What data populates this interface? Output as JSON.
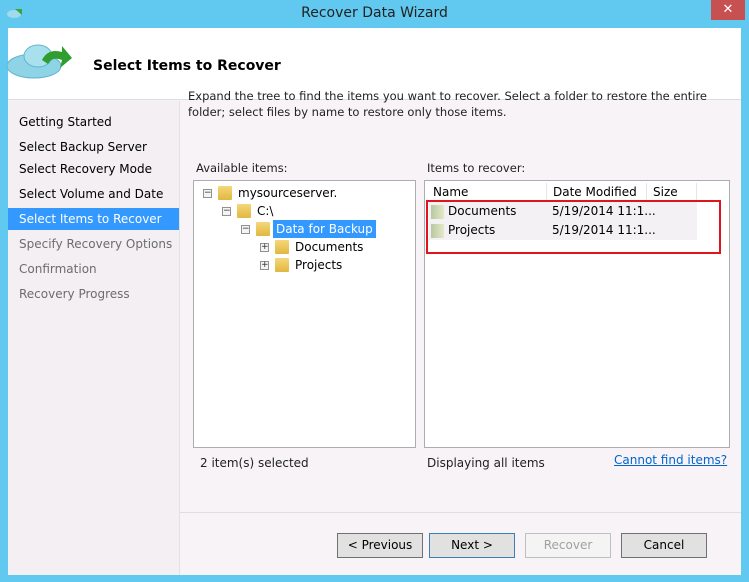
{
  "window": {
    "title": "Recover Data Wizard",
    "close_label": "✕"
  },
  "header": {
    "title": "Select Items to Recover"
  },
  "sidebar": {
    "items": [
      {
        "label": "Getting Started",
        "state": "done"
      },
      {
        "label": "Select Backup Server",
        "state": "done"
      },
      {
        "label": "Select Recovery Mode",
        "state": "done"
      },
      {
        "label": "Select Volume and Date",
        "state": "done"
      },
      {
        "label": "Select Items to Recover",
        "state": "active"
      },
      {
        "label": "Specify Recovery Options",
        "state": "pending"
      },
      {
        "label": "Confirmation",
        "state": "pending"
      },
      {
        "label": "Recovery Progress",
        "state": "pending"
      }
    ]
  },
  "main": {
    "instructions": "Expand the tree to find the items you want to recover. Select a folder to restore the entire folder; select files by name to restore only those items.",
    "available_label": "Available items:",
    "recover_label": "Items to recover:",
    "tree": [
      {
        "label": "mysourceserver.",
        "expander": "−"
      },
      {
        "label": "C:\\",
        "expander": "−"
      },
      {
        "label": "Data for Backup",
        "expander": "−",
        "selected": true
      },
      {
        "label": "Documents",
        "expander": "+"
      },
      {
        "label": "Projects",
        "expander": "+"
      }
    ],
    "columns": [
      "Name",
      "Date Modified",
      "Size"
    ],
    "rows": [
      {
        "name": "Documents",
        "date": "5/19/2014 11:1...",
        "size": ""
      },
      {
        "name": "Projects",
        "date": "5/19/2014 11:1...",
        "size": ""
      }
    ],
    "selected_status": "2 item(s) selected",
    "display_status": "Displaying all items",
    "cannot_find_link": "Cannot find items?"
  },
  "buttons": {
    "previous": "< Previous",
    "next": "Next >",
    "recover": "Recover",
    "cancel": "Cancel"
  },
  "colors": {
    "frame": "#61c8ef",
    "selection": "#3399ff",
    "highlight_box": "#e0141c",
    "link": "#0066cc"
  }
}
